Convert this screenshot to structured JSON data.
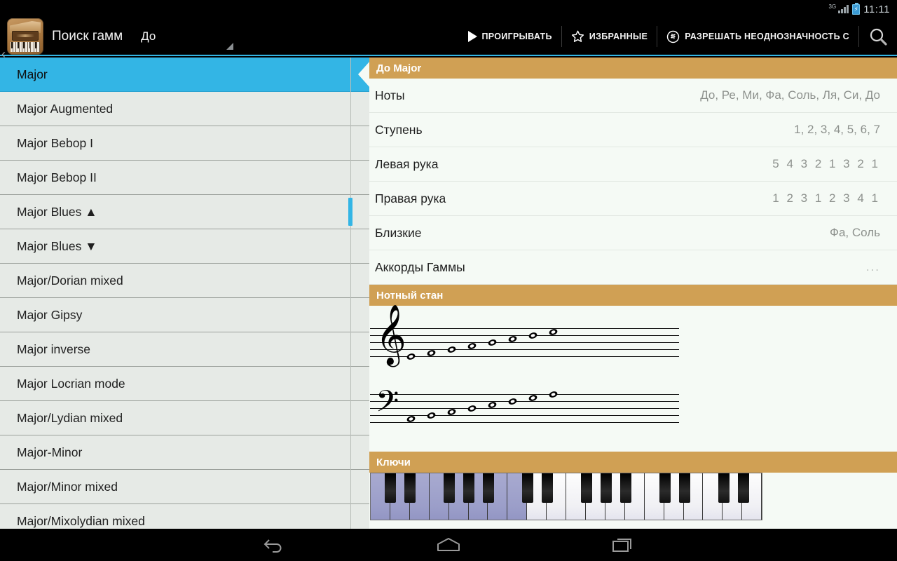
{
  "status_bar": {
    "network": "3G",
    "time": "11:11",
    "signal_icon": "signal-bars-icon",
    "battery_icon": "battery-charging-icon"
  },
  "action_bar": {
    "app_icon": "piano-app-icon",
    "back_icon": "back-caret-icon",
    "title": "Поиск гамм",
    "spinner_value": "До",
    "spinner_icon": "dropdown-triangle-icon",
    "actions": [
      {
        "label": "ПРОИГРЫВАТЬ",
        "icon": "play-icon"
      },
      {
        "label": "ИЗБРАННЫЕ",
        "icon": "star-icon"
      },
      {
        "label": "РАЗРЕШАТЬ НЕОДНОЗНАЧНОСТЬ С",
        "icon": "ambiguity-icon"
      }
    ],
    "search_icon": "search-icon"
  },
  "scale_list": {
    "selected_index": 0,
    "items": [
      {
        "label": "Major"
      },
      {
        "label": "Major Augmented"
      },
      {
        "label": "Major Bebop I"
      },
      {
        "label": "Major Bebop II"
      },
      {
        "label": "Major Blues ▲"
      },
      {
        "label": "Major Blues ▼"
      },
      {
        "label": "Major/Dorian mixed"
      },
      {
        "label": "Major Gipsy"
      },
      {
        "label": "Major inverse"
      },
      {
        "label": "Major Locrian mode"
      },
      {
        "label": "Major/Lydian mixed"
      },
      {
        "label": "Major-Minor"
      },
      {
        "label": "Major/Minor mixed"
      },
      {
        "label": "Major/Mixolydian mixed"
      }
    ]
  },
  "detail": {
    "title": "До Major",
    "rows": [
      {
        "key": "Ноты",
        "value": "До, Ре, Ми, Фа, Соль, Ля, Си, До"
      },
      {
        "key": "Ступень",
        "value": "1, 2, 3, 4, 5, 6, 7"
      },
      {
        "key": "Левая рука",
        "value": "5 4 3 2 1 3 2 1"
      },
      {
        "key": "Правая рука",
        "value": "1 2 3 1 2 3 4 1"
      },
      {
        "key": "Близкие",
        "value": "Фа, Соль"
      },
      {
        "key": "Аккорды Гаммы",
        "value": "..."
      }
    ],
    "staff_title": "Нотный стан",
    "keys_title": "Ключи"
  },
  "notation": {
    "treble_clef_icon": "treble-clef-icon",
    "bass_clef_icon": "bass-clef-icon",
    "note_names": [
      "До",
      "Ре",
      "Ми",
      "Фа",
      "Соль",
      "Ля",
      "Си",
      "До"
    ],
    "treble_note_steps": [
      0,
      1,
      2,
      3,
      4,
      5,
      6,
      7
    ],
    "bass_note_steps": [
      0,
      1,
      2,
      3,
      4,
      5,
      6,
      7
    ],
    "treble_ledger_on": [
      0
    ],
    "bass_ledger_on": [
      7
    ]
  },
  "keyboard": {
    "white_key_count": 20,
    "highlighted_white_keys": [
      0,
      1,
      2,
      3,
      4,
      5,
      6,
      7
    ],
    "black_key_pattern": [
      0,
      1,
      3,
      4,
      5
    ]
  },
  "nav_bar": {
    "items": [
      {
        "icon": "back-icon"
      },
      {
        "icon": "home-icon"
      },
      {
        "icon": "recents-icon"
      }
    ]
  },
  "colors": {
    "accent_blue": "#33b5e5",
    "section_header": "#d0a054",
    "list_bg": "#e6eae6",
    "detail_bg": "#f5faf5",
    "key_highlight": "#9b9ec9"
  }
}
